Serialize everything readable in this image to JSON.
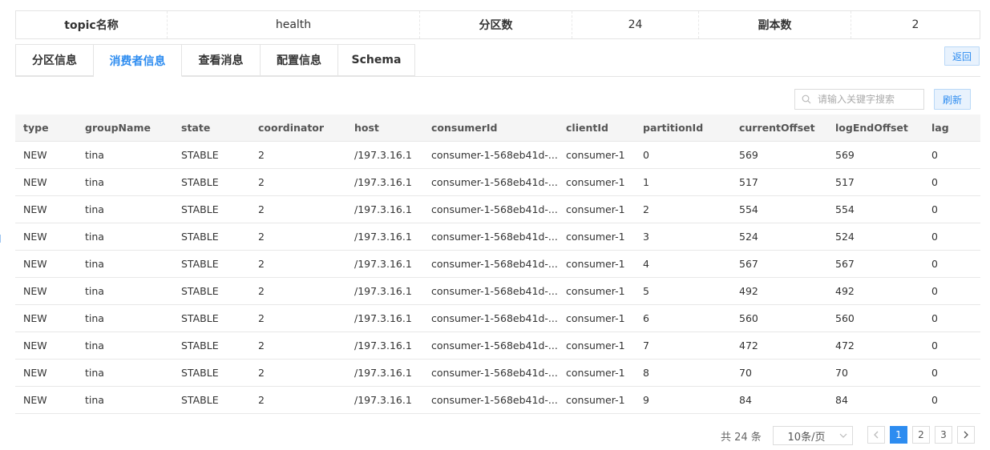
{
  "info": {
    "topic_label": "topic名称",
    "topic_value": "health",
    "partitions_label": "分区数",
    "partitions_value": "24",
    "replicas_label": "副本数",
    "replicas_value": "2"
  },
  "tabs": [
    {
      "label": "分区信息",
      "active": false
    },
    {
      "label": "消费者信息",
      "active": true
    },
    {
      "label": "查看消息",
      "active": false
    },
    {
      "label": "配置信息",
      "active": false
    },
    {
      "label": "Schema",
      "active": false
    }
  ],
  "back_label": "返回",
  "search": {
    "placeholder": "请输入关键字搜索"
  },
  "refresh_label": "刷新",
  "table": {
    "columns": [
      "type",
      "groupName",
      "state",
      "coordinator",
      "host",
      "consumerId",
      "clientId",
      "partitionId",
      "currentOffset",
      "logEndOffset",
      "lag"
    ],
    "rows": [
      [
        "NEW",
        "tina",
        "STABLE",
        "2",
        "/197.3.16.1",
        "consumer-1-568eb41d-...",
        "consumer-1",
        "0",
        "569",
        "569",
        "0"
      ],
      [
        "NEW",
        "tina",
        "STABLE",
        "2",
        "/197.3.16.1",
        "consumer-1-568eb41d-...",
        "consumer-1",
        "1",
        "517",
        "517",
        "0"
      ],
      [
        "NEW",
        "tina",
        "STABLE",
        "2",
        "/197.3.16.1",
        "consumer-1-568eb41d-...",
        "consumer-1",
        "2",
        "554",
        "554",
        "0"
      ],
      [
        "NEW",
        "tina",
        "STABLE",
        "2",
        "/197.3.16.1",
        "consumer-1-568eb41d-...",
        "consumer-1",
        "3",
        "524",
        "524",
        "0"
      ],
      [
        "NEW",
        "tina",
        "STABLE",
        "2",
        "/197.3.16.1",
        "consumer-1-568eb41d-...",
        "consumer-1",
        "4",
        "567",
        "567",
        "0"
      ],
      [
        "NEW",
        "tina",
        "STABLE",
        "2",
        "/197.3.16.1",
        "consumer-1-568eb41d-...",
        "consumer-1",
        "5",
        "492",
        "492",
        "0"
      ],
      [
        "NEW",
        "tina",
        "STABLE",
        "2",
        "/197.3.16.1",
        "consumer-1-568eb41d-...",
        "consumer-1",
        "6",
        "560",
        "560",
        "0"
      ],
      [
        "NEW",
        "tina",
        "STABLE",
        "2",
        "/197.3.16.1",
        "consumer-1-568eb41d-...",
        "consumer-1",
        "7",
        "472",
        "472",
        "0"
      ],
      [
        "NEW",
        "tina",
        "STABLE",
        "2",
        "/197.3.16.1",
        "consumer-1-568eb41d-...",
        "consumer-1",
        "8",
        "70",
        "70",
        "0"
      ],
      [
        "NEW",
        "tina",
        "STABLE",
        "2",
        "/197.3.16.1",
        "consumer-1-568eb41d-...",
        "consumer-1",
        "9",
        "84",
        "84",
        "0"
      ]
    ]
  },
  "pagination": {
    "total_text": "共 24 条",
    "page_size": "10条/页",
    "pages": [
      "1",
      "2",
      "3"
    ],
    "current": "1"
  },
  "colors": {
    "accent": "#2d8cf0"
  }
}
